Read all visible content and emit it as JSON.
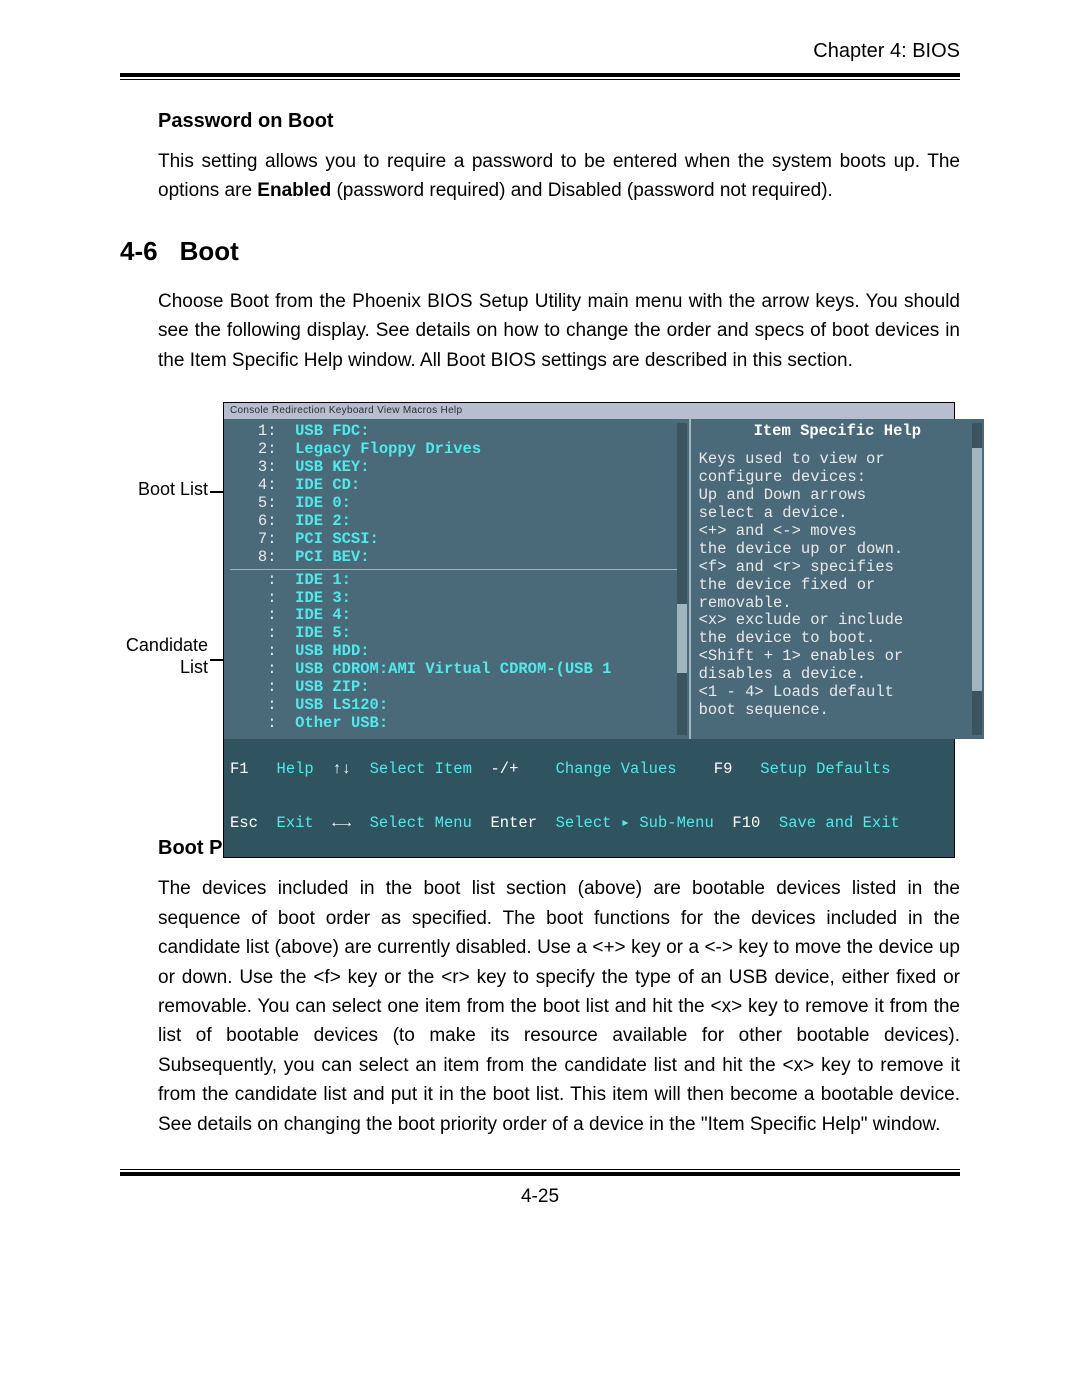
{
  "header": {
    "chapter": "Chapter 4: BIOS"
  },
  "sec_pw": {
    "heading": "Password on Boot",
    "p_a": "This setting allows you to require a password to be entered when the system boots up.  The options are ",
    "p_b_bold": "Enabled",
    "p_c": " (password required) and Disabled (password not required)."
  },
  "sec_boot": {
    "num": "4-6",
    "title": "Boot",
    "intro": "Choose Boot from the Phoenix BIOS Setup Utility main menu with the arrow keys. You should see the following display.  See details on how to change the order and specs of boot devices in the Item Specific Help window.  All Boot BIOS settings are described in this section."
  },
  "labels": {
    "boot_list": "Boot List",
    "candidate_list_l1": "Candidate",
    "candidate_list_l2": "List"
  },
  "bios": {
    "menubar": "Console Redirection  Keyboard  View  Macros  Help",
    "boot_list": [
      {
        "n": "1:",
        "d": "USB FDC:"
      },
      {
        "n": "2:",
        "d": "Legacy Floppy Drives"
      },
      {
        "n": "3:",
        "d": "USB KEY:"
      },
      {
        "n": "4:",
        "d": "IDE CD:"
      },
      {
        "n": "5:",
        "d": "IDE 0:"
      },
      {
        "n": "6:",
        "d": "IDE 2:"
      },
      {
        "n": "7:",
        "d": "PCI SCSI:"
      },
      {
        "n": "8:",
        "d": "PCI BEV:"
      }
    ],
    "candidate_list": [
      {
        "n": ":",
        "d": "IDE 1:"
      },
      {
        "n": ":",
        "d": "IDE 3:"
      },
      {
        "n": ":",
        "d": "IDE 4:"
      },
      {
        "n": ":",
        "d": "IDE 5:"
      },
      {
        "n": ":",
        "d": "USB HDD:"
      },
      {
        "n": ":",
        "d": "USB CDROM:AMI Virtual CDROM-(USB 1"
      },
      {
        "n": ":",
        "d": "USB ZIP:"
      },
      {
        "n": ":",
        "d": "USB LS120:"
      },
      {
        "n": ":",
        "d": "Other USB:"
      }
    ],
    "help_title": "Item Specific Help",
    "help_lines": [
      "Keys used to view or",
      "configure devices:",
      "Up and Down arrows",
      "select a device.",
      "<+> and <-> moves",
      "the device up or down.",
      "<f> and <r> specifies",
      "the device fixed or",
      "removable.",
      "<x> exclude or include",
      "the device to boot.",
      "<Shift + 1> enables or",
      "disables a device.",
      "<1 - 4> Loads default",
      "boot sequence."
    ],
    "footer": {
      "r1": {
        "k1": "F1",
        "v1": "Help",
        "k2": "↑↓",
        "v2": "Select Item",
        "k3": "-/+",
        "v3": "Change Values",
        "k4": "F9",
        "v4": "Setup Defaults"
      },
      "r2": {
        "k1": "Esc",
        "v1": "Exit",
        "k2": "←→",
        "v2": "Select Menu",
        "k3": "Enter",
        "v3": "Select ▸ Sub-Menu",
        "k4": "F10",
        "v4": "Save and Exit"
      }
    }
  },
  "sec_priority": {
    "heading": "Boot Priority Order/Excluded from Boot Orders",
    "body": "The devices included in the boot list section (above) are bootable devices listed in the sequence of boot order as specified. The boot functions for the devices included in the candidate list (above) are currently disabled.  Use a <+> key or a <-> key to move the device up or down. Use the <f> key or the <r> key to specify the type of an USB device, either fixed or removable. You can select one item from the boot list and hit the <x> key to remove it from the list of bootable devices (to make its resource available for other bootable devices). Subsequently, you can select an item from the candidate list and hit the <x> key  to remove it from the candidate list and put it in the boot list. This item will then become a bootable device. See details on changing the boot priority order of a device in the \"Item Specific Help\" window."
  },
  "page_number": "4-25"
}
